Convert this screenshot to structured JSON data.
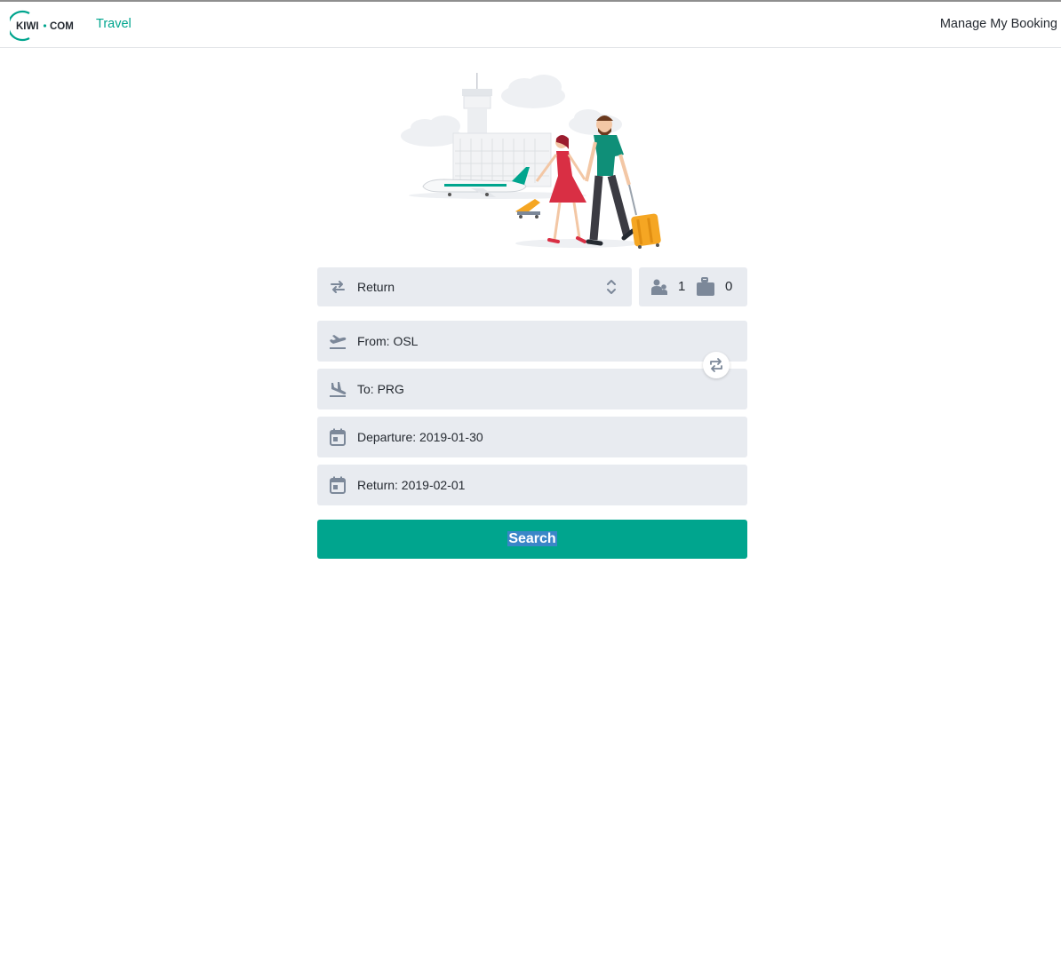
{
  "header": {
    "logo_text": "KIWI·COM",
    "nav_travel": "Travel",
    "manage_booking": "Manage My Booking"
  },
  "search_form": {
    "trip_type": {
      "value": "Return",
      "icon": "swap-arrows-icon"
    },
    "passengers": {
      "count": "1",
      "icon": "passenger-icon"
    },
    "bags": {
      "count": "0",
      "icon": "baggage-icon"
    },
    "from": {
      "value": "From: OSL",
      "icon": "takeoff-icon"
    },
    "to": {
      "value": "To: PRG",
      "icon": "landing-icon"
    },
    "departure": {
      "value": "Departure: 2019-01-30",
      "icon": "calendar-icon"
    },
    "return": {
      "value": "Return: 2019-02-01",
      "icon": "calendar-icon"
    },
    "swap_button_icon": "swap-icon",
    "search_button": "Search"
  },
  "colors": {
    "brand": "#00a58e",
    "field_bg": "#e8ebf0",
    "icon": "#7c8899",
    "text": "#252a31"
  }
}
